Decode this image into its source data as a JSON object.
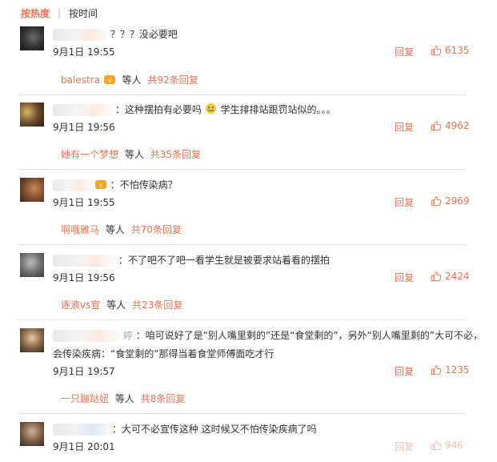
{
  "tabs": {
    "hot": "按热度",
    "time": "按时间"
  },
  "reply_label": "回复",
  "etc_label": "等人",
  "comments": [
    {
      "text": "？？？没必要吧",
      "time": "9月1日 19:55",
      "likes": "6135",
      "sub_user": "balestra",
      "sub_total": "共92条回复"
    },
    {
      "text_a": "：这种摆拍有必要吗",
      "text_b": "学生排排站跟罚站似的。。。",
      "time": "9月1日 19:56",
      "likes": "4962",
      "sub_user": "她有一个梦想",
      "sub_total": "共35条回复"
    },
    {
      "text": "：不怕传染病？",
      "time": "9月1日 19:55",
      "likes": "2969",
      "sub_user": "啊哦雅马",
      "sub_total": "共70条回复"
    },
    {
      "text": "：不了吧不了吧一看学生就是被要求站着看的摆拍",
      "time": "9月1日 19:56",
      "likes": "2424",
      "sub_user": "逐浪vs宣",
      "sub_total": "共23条回复"
    },
    {
      "user_tail": "婷",
      "text": "：咱可说好了是“别人嘴里剩的”还是“食堂剩的”，另外“别人嘴里剩的”大可不必，",
      "text2": "会传染疾病：“食堂剩的”那得当着食堂师傅面吃才行",
      "time": "9月1日 19:57",
      "likes": "1235",
      "sub_user": "一只蹦跶妞",
      "sub_total": "共8条回复"
    },
    {
      "text": "：大可不必宣传这种 这时候又不怕传染疾病了吗",
      "time": "9月1日 20:01",
      "likes": "946"
    }
  ]
}
